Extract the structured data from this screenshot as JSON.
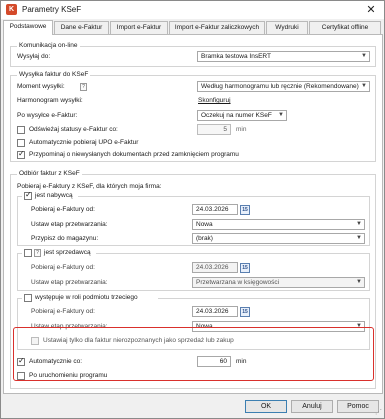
{
  "window": {
    "title": "Parametry KSeF",
    "close_glyph": "✕"
  },
  "tabs": [
    "Podstawowe",
    "Dane e-Faktur",
    "Import e-Faktur",
    "Import e-Faktur zaliczkowych",
    "Wydruki",
    "Certyfikat offline"
  ],
  "komunikacja": {
    "group_label": "Komunikacja on-line",
    "wysylaj_label": "Wysyłaj do:",
    "wysylaj_value": "Bramka testowa InsERT"
  },
  "wysylka": {
    "group_label": "Wysyłka faktur do KSeF",
    "moment_label": "Moment wysyłki:",
    "moment_value": "Według harmonogramu lub ręcznie (Rekomendowane)",
    "harmonogram_label": "Harmonogram wysyłki:",
    "harmonogram_link": "Skonfiguruj",
    "po_wysylce_label": "Po wysyłce e-Faktur:",
    "po_wysylce_value": "Oczekuj na numer KSeF",
    "odswiezaj_label": "Odświeżaj statusy e-Faktur co:",
    "odswiezaj_value": "5",
    "odswiezaj_unit": "min",
    "upo_label": "Automatycznie pobieraj UPO e-Faktur",
    "przypominaj_label": "Przypominaj o niewysłanych dokumentach przed zamknięciem programu"
  },
  "odbior": {
    "group_label": "Odbiór faktur z KSeF",
    "intro": "Pobieraj e-Faktury z KSeF, dla których moja firma:",
    "nabywca": {
      "label": "jest nabywcą",
      "pobieraj_label": "Pobieraj e-Faktury od:",
      "date": "24.03.2026",
      "etap_label": "Ustaw etap przetwarzania:",
      "etap_value": "Nowa",
      "magazyn_label": "Przypisz do magazynu:",
      "magazyn_value": "(brak)"
    },
    "sprzedawca": {
      "label": "jest sprzedawcą",
      "pobieraj_label": "Pobieraj e-Faktury od:",
      "date": "24.03.2026",
      "etap_label": "Ustaw etap przetwarzania:",
      "etap_value": "Przetwarzana w księgowości"
    },
    "trzeci": {
      "label": "występuje w roli podmiotu trzeciego",
      "pobieraj_label": "Pobieraj e-Faktury od:",
      "date": "24.03.2026",
      "etap_label": "Ustaw etap przetwarzania:",
      "etap_value": "Nowa",
      "ustawiaj_label": "Ustawiaj tylko dla faktur nierozpoznanych jako sprzedaż lub zakup"
    },
    "auto_label": "Automatycznie co:",
    "auto_value": "60",
    "auto_unit": "min",
    "po_uruchomieniu_label": "Po uruchomieniu programu"
  },
  "buttons": {
    "ok": "OK",
    "anuluj": "Anuluj",
    "pomoc": "Pomoc"
  },
  "colors": {
    "highlight": "#d9302c",
    "accent": "#3c7fb1"
  }
}
